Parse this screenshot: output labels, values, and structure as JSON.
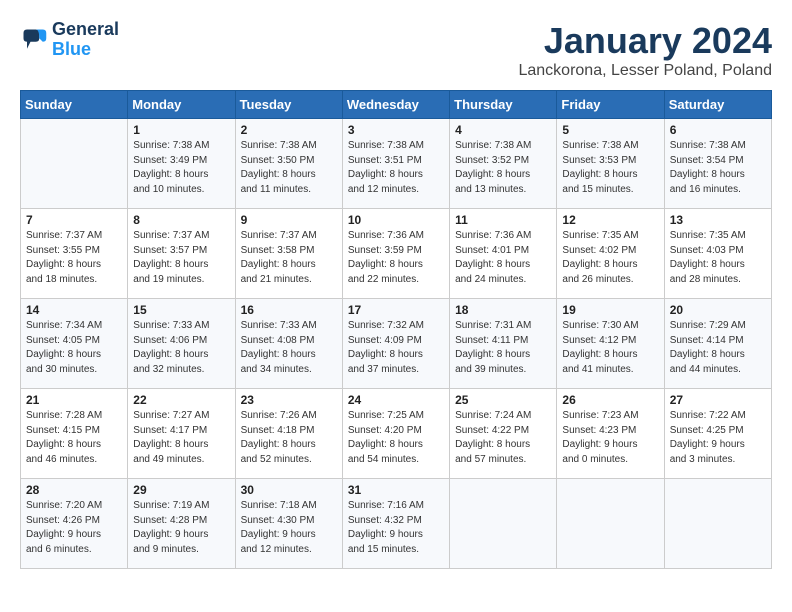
{
  "logo": {
    "line1": "General",
    "line2": "Blue"
  },
  "title": "January 2024",
  "location": "Lanckorona, Lesser Poland, Poland",
  "weekdays": [
    "Sunday",
    "Monday",
    "Tuesday",
    "Wednesday",
    "Thursday",
    "Friday",
    "Saturday"
  ],
  "weeks": [
    [
      {
        "day": "",
        "info": ""
      },
      {
        "day": "1",
        "info": "Sunrise: 7:38 AM\nSunset: 3:49 PM\nDaylight: 8 hours\nand 10 minutes."
      },
      {
        "day": "2",
        "info": "Sunrise: 7:38 AM\nSunset: 3:50 PM\nDaylight: 8 hours\nand 11 minutes."
      },
      {
        "day": "3",
        "info": "Sunrise: 7:38 AM\nSunset: 3:51 PM\nDaylight: 8 hours\nand 12 minutes."
      },
      {
        "day": "4",
        "info": "Sunrise: 7:38 AM\nSunset: 3:52 PM\nDaylight: 8 hours\nand 13 minutes."
      },
      {
        "day": "5",
        "info": "Sunrise: 7:38 AM\nSunset: 3:53 PM\nDaylight: 8 hours\nand 15 minutes."
      },
      {
        "day": "6",
        "info": "Sunrise: 7:38 AM\nSunset: 3:54 PM\nDaylight: 8 hours\nand 16 minutes."
      }
    ],
    [
      {
        "day": "7",
        "info": "Sunrise: 7:37 AM\nSunset: 3:55 PM\nDaylight: 8 hours\nand 18 minutes."
      },
      {
        "day": "8",
        "info": "Sunrise: 7:37 AM\nSunset: 3:57 PM\nDaylight: 8 hours\nand 19 minutes."
      },
      {
        "day": "9",
        "info": "Sunrise: 7:37 AM\nSunset: 3:58 PM\nDaylight: 8 hours\nand 21 minutes."
      },
      {
        "day": "10",
        "info": "Sunrise: 7:36 AM\nSunset: 3:59 PM\nDaylight: 8 hours\nand 22 minutes."
      },
      {
        "day": "11",
        "info": "Sunrise: 7:36 AM\nSunset: 4:01 PM\nDaylight: 8 hours\nand 24 minutes."
      },
      {
        "day": "12",
        "info": "Sunrise: 7:35 AM\nSunset: 4:02 PM\nDaylight: 8 hours\nand 26 minutes."
      },
      {
        "day": "13",
        "info": "Sunrise: 7:35 AM\nSunset: 4:03 PM\nDaylight: 8 hours\nand 28 minutes."
      }
    ],
    [
      {
        "day": "14",
        "info": "Sunrise: 7:34 AM\nSunset: 4:05 PM\nDaylight: 8 hours\nand 30 minutes."
      },
      {
        "day": "15",
        "info": "Sunrise: 7:33 AM\nSunset: 4:06 PM\nDaylight: 8 hours\nand 32 minutes."
      },
      {
        "day": "16",
        "info": "Sunrise: 7:33 AM\nSunset: 4:08 PM\nDaylight: 8 hours\nand 34 minutes."
      },
      {
        "day": "17",
        "info": "Sunrise: 7:32 AM\nSunset: 4:09 PM\nDaylight: 8 hours\nand 37 minutes."
      },
      {
        "day": "18",
        "info": "Sunrise: 7:31 AM\nSunset: 4:11 PM\nDaylight: 8 hours\nand 39 minutes."
      },
      {
        "day": "19",
        "info": "Sunrise: 7:30 AM\nSunset: 4:12 PM\nDaylight: 8 hours\nand 41 minutes."
      },
      {
        "day": "20",
        "info": "Sunrise: 7:29 AM\nSunset: 4:14 PM\nDaylight: 8 hours\nand 44 minutes."
      }
    ],
    [
      {
        "day": "21",
        "info": "Sunrise: 7:28 AM\nSunset: 4:15 PM\nDaylight: 8 hours\nand 46 minutes."
      },
      {
        "day": "22",
        "info": "Sunrise: 7:27 AM\nSunset: 4:17 PM\nDaylight: 8 hours\nand 49 minutes."
      },
      {
        "day": "23",
        "info": "Sunrise: 7:26 AM\nSunset: 4:18 PM\nDaylight: 8 hours\nand 52 minutes."
      },
      {
        "day": "24",
        "info": "Sunrise: 7:25 AM\nSunset: 4:20 PM\nDaylight: 8 hours\nand 54 minutes."
      },
      {
        "day": "25",
        "info": "Sunrise: 7:24 AM\nSunset: 4:22 PM\nDaylight: 8 hours\nand 57 minutes."
      },
      {
        "day": "26",
        "info": "Sunrise: 7:23 AM\nSunset: 4:23 PM\nDaylight: 9 hours\nand 0 minutes."
      },
      {
        "day": "27",
        "info": "Sunrise: 7:22 AM\nSunset: 4:25 PM\nDaylight: 9 hours\nand 3 minutes."
      }
    ],
    [
      {
        "day": "28",
        "info": "Sunrise: 7:20 AM\nSunset: 4:26 PM\nDaylight: 9 hours\nand 6 minutes."
      },
      {
        "day": "29",
        "info": "Sunrise: 7:19 AM\nSunset: 4:28 PM\nDaylight: 9 hours\nand 9 minutes."
      },
      {
        "day": "30",
        "info": "Sunrise: 7:18 AM\nSunset: 4:30 PM\nDaylight: 9 hours\nand 12 minutes."
      },
      {
        "day": "31",
        "info": "Sunrise: 7:16 AM\nSunset: 4:32 PM\nDaylight: 9 hours\nand 15 minutes."
      },
      {
        "day": "",
        "info": ""
      },
      {
        "day": "",
        "info": ""
      },
      {
        "day": "",
        "info": ""
      }
    ]
  ]
}
